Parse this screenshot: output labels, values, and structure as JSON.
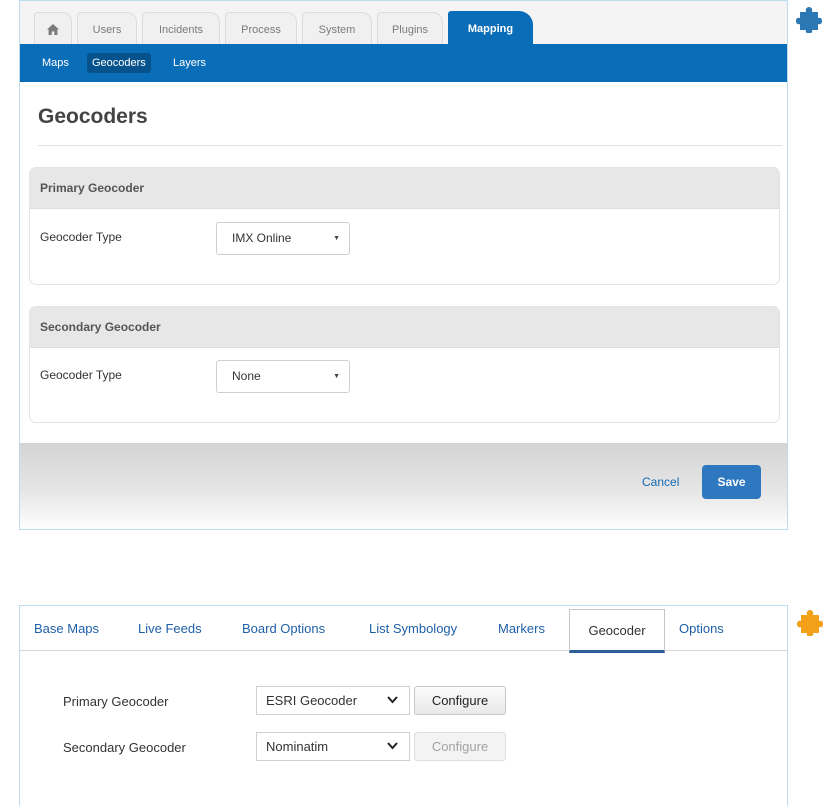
{
  "colors": {
    "accent_blue": "#0a6db7",
    "save_button": "#2e78c0",
    "link_blue": "#1469b3",
    "tab_link_blue": "#1f5fa8",
    "puzzle_blue": "#2b78b4",
    "puzzle_orange": "#f2a118"
  },
  "top_panel": {
    "tabs": [
      {
        "label": "",
        "icon": "home-icon"
      },
      {
        "label": "Users"
      },
      {
        "label": "Incidents"
      },
      {
        "label": "Process"
      },
      {
        "label": "System"
      },
      {
        "label": "Plugins"
      },
      {
        "label": "Mapping",
        "active": true
      }
    ],
    "subnav": [
      {
        "label": "Maps"
      },
      {
        "label": "Geocoders",
        "active": true
      },
      {
        "label": "Layers"
      }
    ],
    "title": "Geocoders",
    "primary": {
      "heading": "Primary Geocoder",
      "field_label": "Geocoder Type",
      "value": "IMX Online"
    },
    "secondary": {
      "heading": "Secondary Geocoder",
      "field_label": "Geocoder Type",
      "value": "None"
    },
    "cancel_label": "Cancel",
    "save_label": "Save"
  },
  "bottom_panel": {
    "tabs": [
      {
        "label": "Base Maps"
      },
      {
        "label": "Live Feeds"
      },
      {
        "label": "Board Options"
      },
      {
        "label": "List Symbology"
      },
      {
        "label": "Markers"
      },
      {
        "label": "Geocoder",
        "active": true
      },
      {
        "label": "Options"
      }
    ],
    "primary": {
      "label": "Primary Geocoder",
      "value": "ESRI Geocoder",
      "button": "Configure",
      "button_enabled": true
    },
    "secondary": {
      "label": "Secondary Geocoder",
      "value": "Nominatim",
      "button": "Configure",
      "button_enabled": false
    }
  },
  "icons": [
    "home-icon",
    "dropdown-caret-icon",
    "chevron-down-icon",
    "puzzle-piece-icon"
  ]
}
